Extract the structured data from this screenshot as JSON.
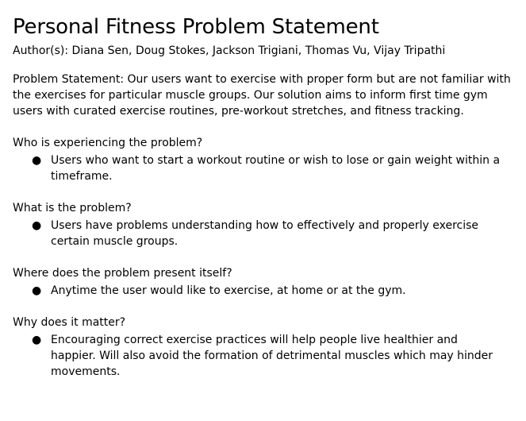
{
  "document": {
    "title": "Personal Fitness Problem Statement",
    "authors": "Author(s): Diana Sen, Doug Stokes, Jackson Trigiani, Thomas Vu, Vijay Tripathi",
    "problem_statement": "Problem Statement: Our users want to exercise with proper form but are not familiar with the exercises for particular muscle groups. Our solution aims to inform first time gym users with curated exercise routines, pre-workout stretches, and fitness tracking.",
    "bullet_char": "●",
    "sections": [
      {
        "question": "Who is experiencing the problem?",
        "answer": "Users who want to start a workout routine or wish to lose or gain weight within a timeframe."
      },
      {
        "question": "What is the problem?",
        "answer": "Users have problems understanding how to effectively and properly exercise certain muscle groups."
      },
      {
        "question": "Where does the problem present itself?",
        "answer": "Anytime the user would like to exercise, at home or at the gym."
      },
      {
        "question": "Why does it matter?",
        "answer": "Encouraging correct exercise practices will help people live healthier and happier. Will also avoid the formation of detrimental muscles which may hinder movements."
      }
    ]
  }
}
